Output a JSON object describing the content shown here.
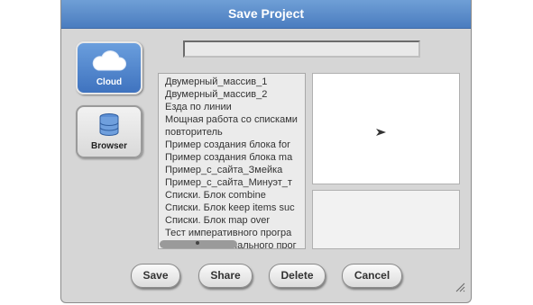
{
  "dialog": {
    "title": "Save Project"
  },
  "name_field": {
    "value": ""
  },
  "sources": {
    "cloud": {
      "label": "Cloud",
      "icon": "cloud-icon",
      "selected": true
    },
    "browser": {
      "label": "Browser",
      "icon": "database-icon",
      "selected": false
    }
  },
  "projects": [
    "Двумерный_массив_1",
    "Двумерный_массив_2",
    "Езда по линии",
    "Мощная работа со списками",
    "повторитель",
    "Пример создания блока for",
    "Пример создания блока ma",
    "Пример_с_сайта_Змейка",
    "Пример_с_сайта_Минуэт_т",
    "Списки. Блок combine",
    "Списки. Блок keep items suc",
    "Списки. Блок map over",
    "Тест императивного програ",
    "нального прог"
  ],
  "buttons": {
    "save": "Save",
    "share": "Share",
    "delete": "Delete",
    "cancel": "Cancel"
  },
  "colors": {
    "title_bar": "#4a7cbf",
    "selected_source": "#4f86cf",
    "dialog_bg": "#d6d6d6"
  }
}
